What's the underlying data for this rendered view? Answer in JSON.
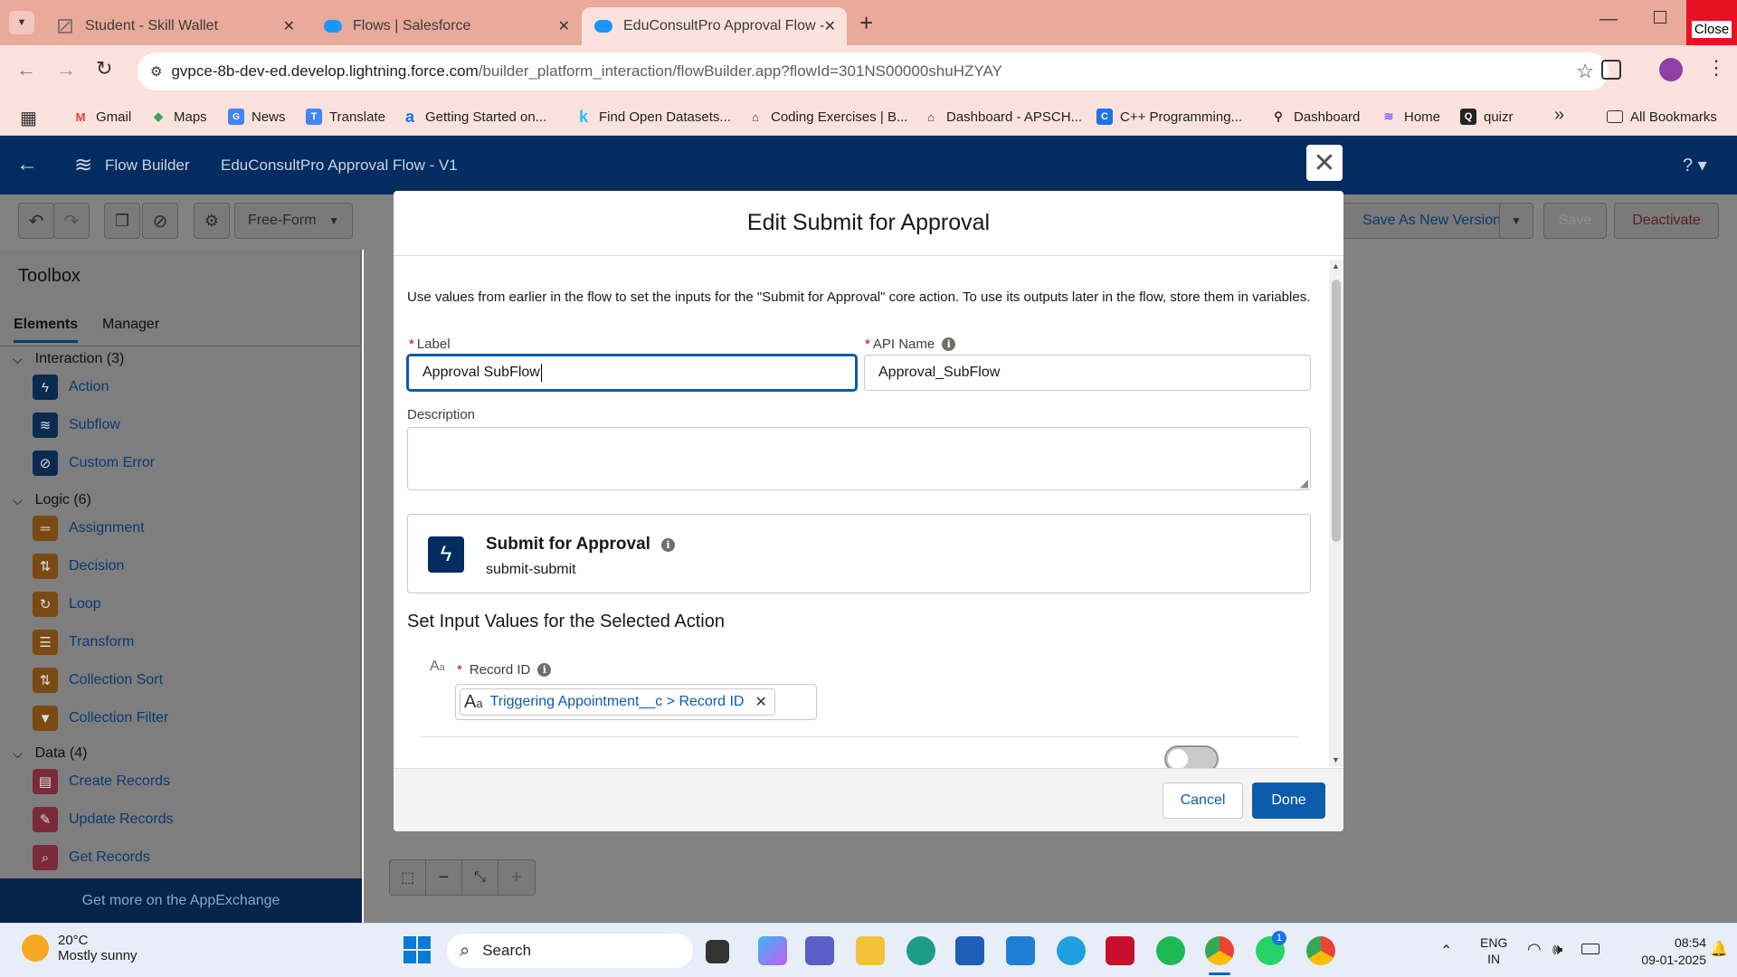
{
  "browser": {
    "tabs": [
      {
        "title": "Student - Skill Wallet"
      },
      {
        "title": "Flows | Salesforce"
      },
      {
        "title": "EduConsultPro Approval Flow -"
      }
    ],
    "close_tooltip": "Close",
    "url_domain": "gvpce-8b-dev-ed.develop.lightning.force.com",
    "url_path": "/builder_platform_interaction/flowBuilder.app?flowId=301NS00000shuHZYAY",
    "bookmarks": [
      "Gmail",
      "Maps",
      "News",
      "Translate",
      "Getting Started on...",
      "Find Open Datasets...",
      "Coding Exercises | B...",
      "Dashboard - APSCH...",
      "C++ Programming...",
      "Dashboard",
      "Home",
      "quizr"
    ],
    "all_bookmarks": "All Bookmarks"
  },
  "app": {
    "name": "Flow Builder",
    "flow_title": "EduConsultPro Approval Flow - V1",
    "mode": "Free-Form",
    "save_as_new": "Save As New Version",
    "save": "Save",
    "deactivate": "Deactivate"
  },
  "toolbox": {
    "title": "Toolbox",
    "tabs": [
      "Elements",
      "Manager"
    ],
    "sections": [
      {
        "label": "Interaction (3)",
        "items": [
          "Action",
          "Subflow",
          "Custom Error"
        ]
      },
      {
        "label": "Logic (6)",
        "items": [
          "Assignment",
          "Decision",
          "Loop",
          "Transform",
          "Collection Sort",
          "Collection Filter"
        ]
      },
      {
        "label": "Data (4)",
        "items": [
          "Create Records",
          "Update Records",
          "Get Records"
        ]
      }
    ],
    "appexchange": "Get more on the AppExchange"
  },
  "modal": {
    "title": "Edit Submit for Approval",
    "intro": "Use values from earlier in the flow to set the inputs for the \"Submit for Approval\" core action. To use its outputs later in the flow, store them in variables.",
    "label_label": "Label",
    "label_value": "Approval SubFlow",
    "api_label": "API Name",
    "api_value": "Approval_SubFlow",
    "desc_label": "Description",
    "desc_value": "",
    "action_title": "Submit for Approval",
    "action_sub": "submit-submit",
    "inputs_heading": "Set Input Values for the Selected Action",
    "record_id_label": "Record ID",
    "record_id_pill": "Triggering Appointment__c > Record ID",
    "cancel": "Cancel",
    "done": "Done"
  },
  "taskbar": {
    "weather_temp": "20°C",
    "weather_desc": "Mostly sunny",
    "search": "Search",
    "lang1": "ENG",
    "lang2": "IN",
    "time": "08:54",
    "date": "09-01-2025",
    "whatsapp_badge": "1"
  }
}
